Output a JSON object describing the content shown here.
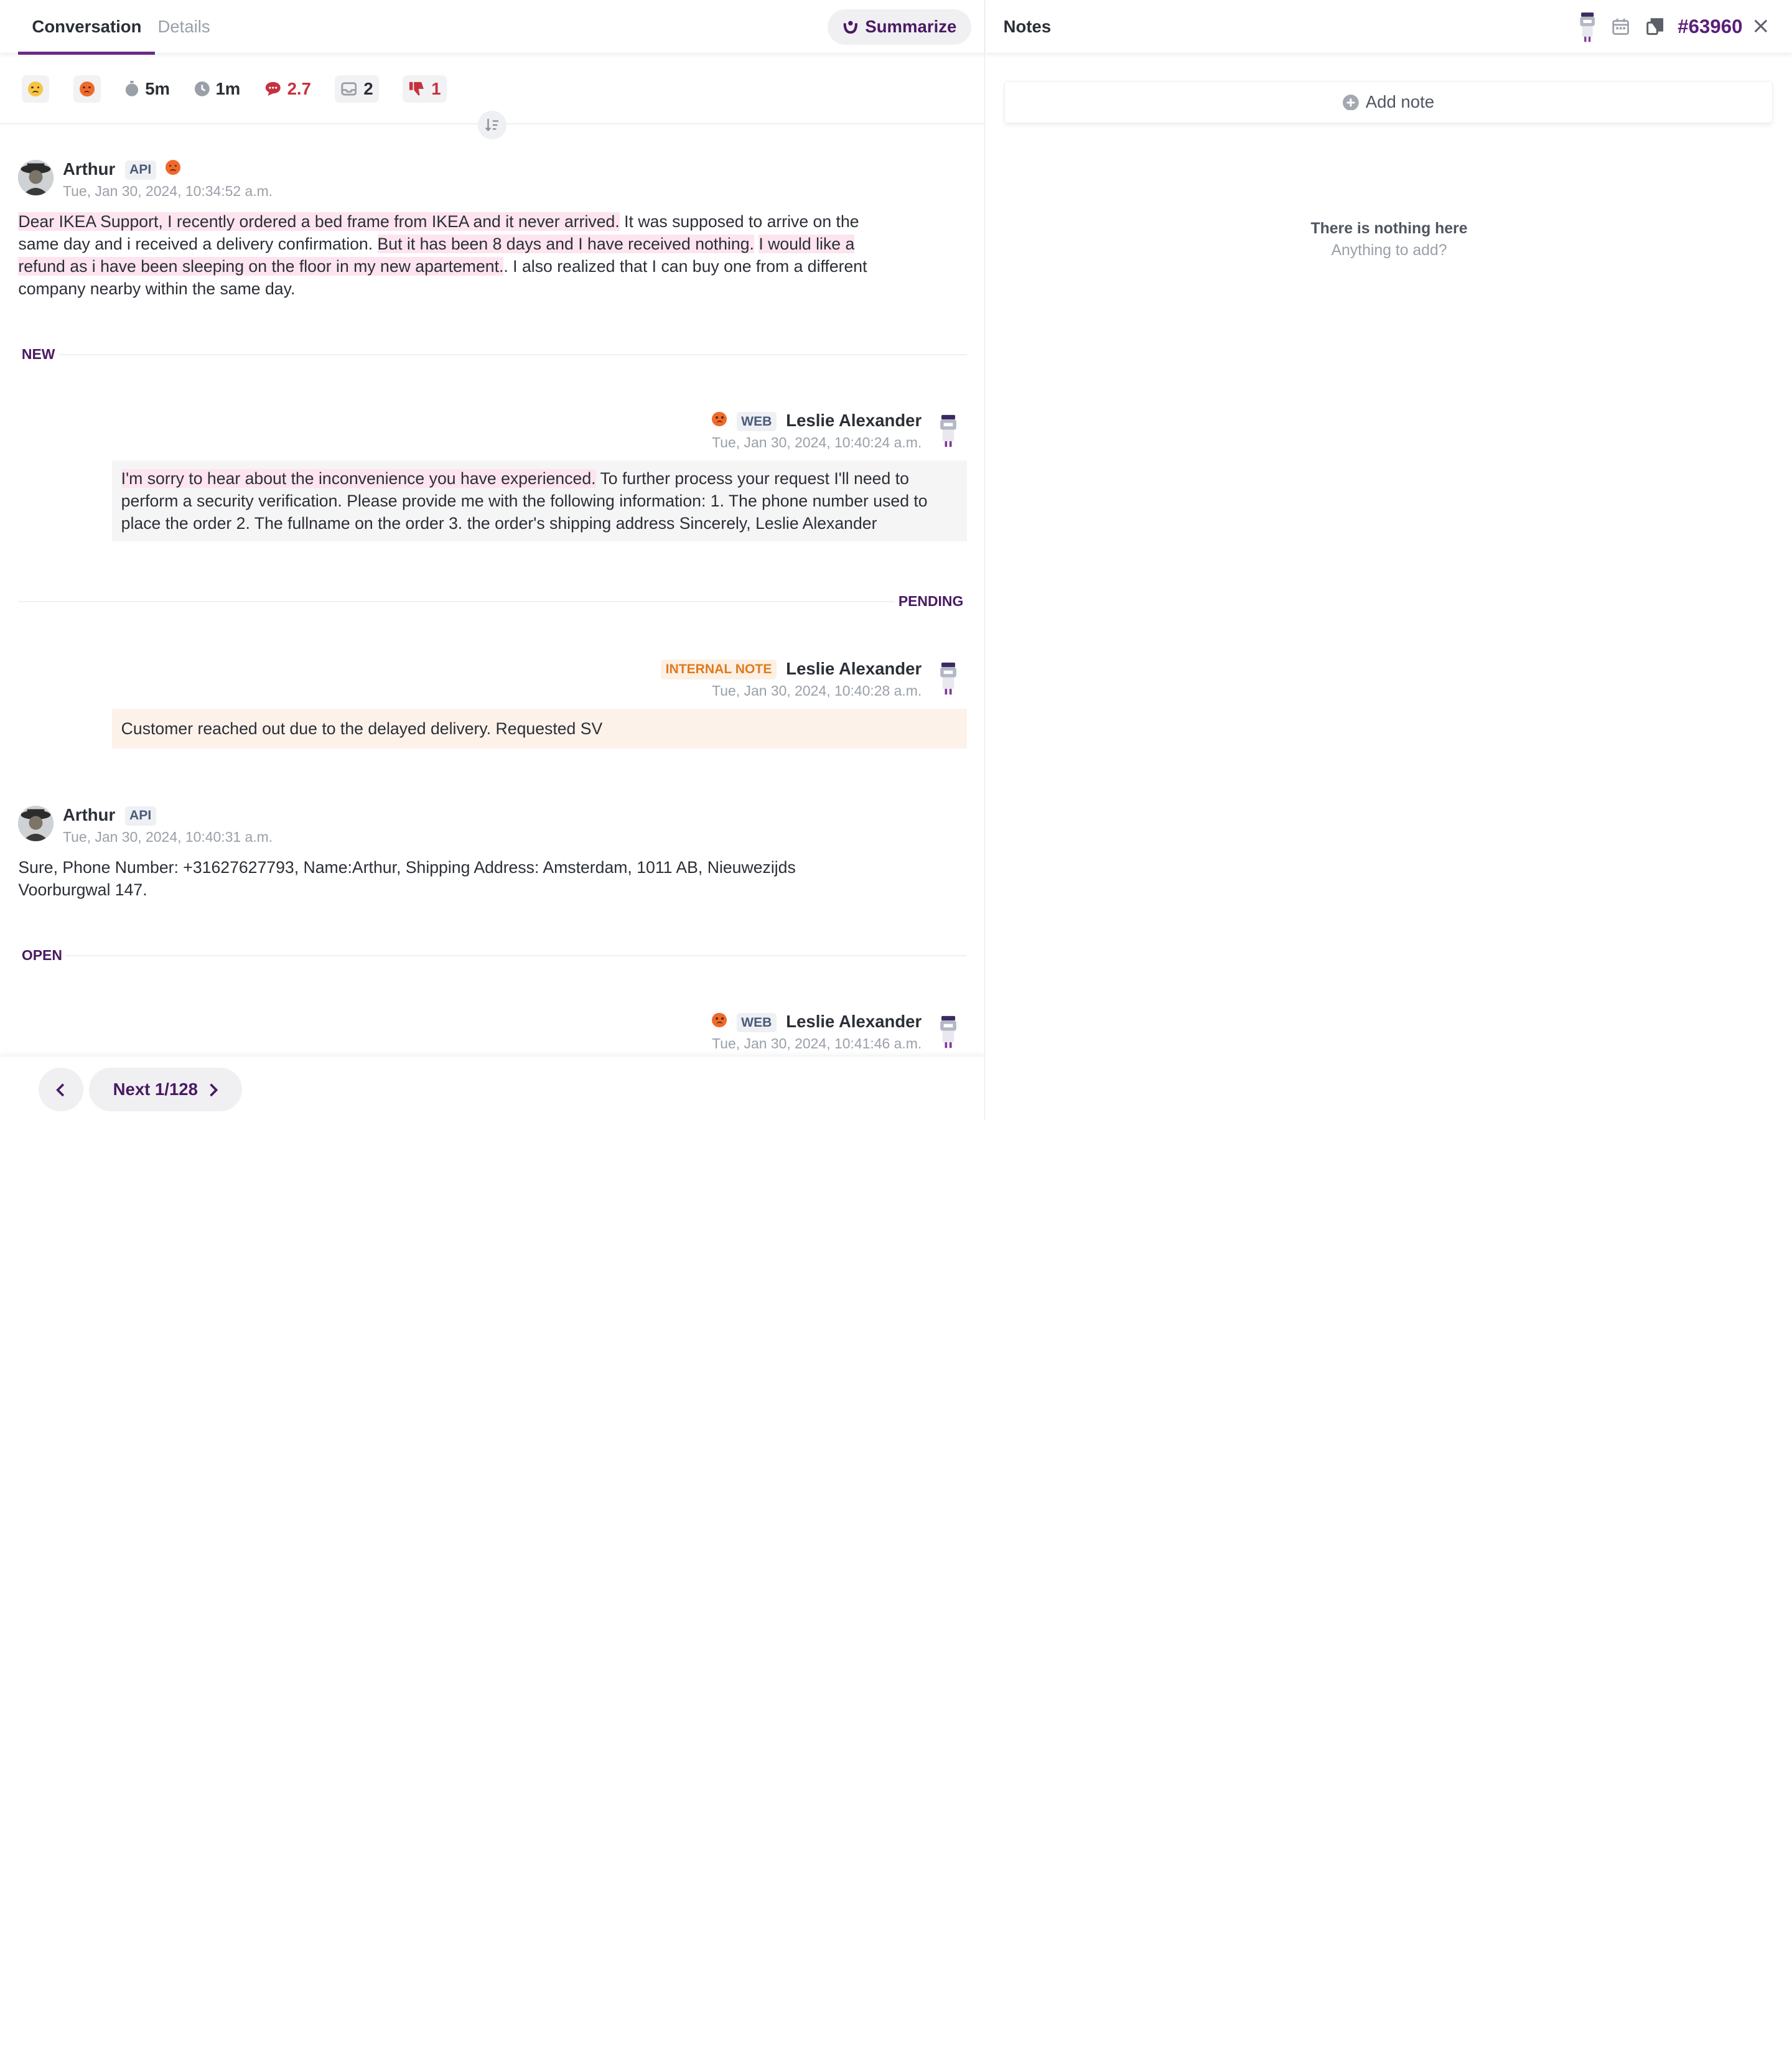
{
  "tabs": {
    "conversation": "Conversation",
    "details": "Details"
  },
  "summarize_label": "Summarize",
  "stats": {
    "time_open": "5m",
    "time_wait": "1m",
    "messages": "2.7",
    "inbox": "2",
    "dislikes": "1"
  },
  "messages": [
    {
      "author": "Arthur",
      "channel": "API",
      "time": "Tue, Jan 30, 2024, 10:34:52 a.m.",
      "text_parts": [
        "Dear IKEA Support, I recently ordered a bed frame from IKEA and it never arrived.",
        " It was supposed to arrive on the same day and i received a delivery confirmation. ",
        "But it has been 8 days and I have received nothing.",
        " ",
        "I would like a refund as i have been sleeping on the floor in my new apartement.",
        ". I also realized that I can buy one from a different company nearby within the same day."
      ]
    },
    {
      "author": "Leslie Alexander",
      "channel": "WEB",
      "time": "Tue, Jan 30, 2024, 10:40:24 a.m.",
      "text_parts": [
        "I'm sorry to hear about the inconvenience you have experienced.",
        " To further process your request I'll need to perform a security verification. Please provide me with the following information: 1. The phone number used to place the order 2. The fullname on the order 3. the order's shipping address Sincerely, Leslie Alexander"
      ]
    },
    {
      "author": "Leslie Alexander",
      "channel": "INTERNAL NOTE",
      "time": "Tue, Jan 30, 2024, 10:40:28 a.m.",
      "text": "Customer reached out due to the delayed delivery. Requested SV"
    },
    {
      "author": "Arthur",
      "channel": "API",
      "time": "Tue, Jan 30, 2024, 10:40:31 a.m.",
      "text": "Sure, Phone Number: +31627627793, Name:Arthur, Shipping Address: Amsterdam, 1011 AB, Nieuwezijds Voorburgwal 147."
    },
    {
      "author": "Leslie Alexander",
      "channel": "WEB",
      "time": "Tue, Jan 30, 2024, 10:41:46 a.m."
    }
  ],
  "status_labels": {
    "new": "NEW",
    "pending": "PENDING",
    "open": "OPEN"
  },
  "pager": {
    "next_label": "Next 1/128"
  },
  "notes": {
    "title": "Notes",
    "ticket_id": "#63960",
    "add_note": "Add note",
    "empty_title": "There is nothing here",
    "empty_sub": "Anything to add?"
  },
  "colors": {
    "brand": "#5a1f7a",
    "highlight": "#fde4ef",
    "note_bg": "#fdf2ea",
    "negative": "#c4323e"
  },
  "icons": [
    "summarize-icon",
    "timer-icon",
    "clock-icon",
    "chat-icon",
    "inbox-icon",
    "thumbs-down-icon",
    "sort-icon",
    "robot-agent-icon",
    "calendar-icon",
    "copy-icon",
    "close-icon",
    "plus-circle-icon",
    "chevron-left-icon",
    "chevron-right-icon"
  ]
}
